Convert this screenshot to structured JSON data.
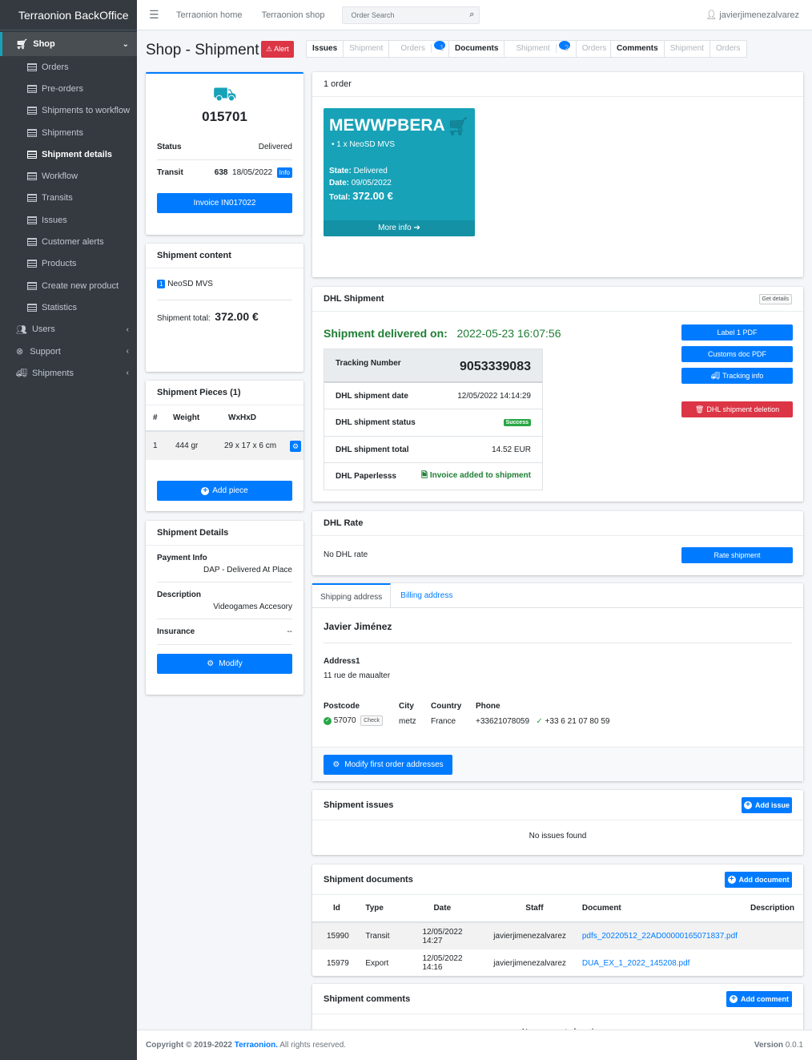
{
  "brand": "Terraonion BackOffice",
  "sidebar": {
    "shop": "Shop",
    "items": [
      "Orders",
      "Pre-orders",
      "Shipments to workflow",
      "Shipments",
      "Shipment details",
      "Workflow",
      "Transits",
      "Issues",
      "Customer alerts",
      "Products",
      "Create new product",
      "Statistics"
    ],
    "users": "Users",
    "support": "Support",
    "shipments": "Shipments"
  },
  "topbar": {
    "home": "Terraonion home",
    "shop": "Terraonion shop",
    "search_placeholder": "Order Search",
    "user": "javierjimenezalvarez"
  },
  "page": {
    "title": "Shop - Shipment",
    "alert": "Alert"
  },
  "tabs1": {
    "a": "Issues",
    "b": "Shipment",
    "c": "Orders",
    "c_badge": "1"
  },
  "tabs2": {
    "a": "Documents",
    "b": "Shipment",
    "b_badge": "2",
    "c": "Orders"
  },
  "tabs3": {
    "a": "Comments",
    "b": "Shipment",
    "c": "Orders"
  },
  "summary": {
    "number": "015701",
    "status_label": "Status",
    "status_value": "Delivered",
    "transit_label": "Transit",
    "transit_id": "638",
    "transit_date": "18/05/2022",
    "info": "Info",
    "invoice_btn": "Invoice IN017022"
  },
  "content": {
    "title": "Shipment content",
    "qty": "1",
    "item": "NeoSD MVS",
    "total_label": "Shipment total:",
    "total_value": "372.00 €"
  },
  "pieces": {
    "title": "Shipment Pieces (1)",
    "h_num": "#",
    "h_weight": "Weight",
    "h_dim": "WxHxD",
    "row_num": "1",
    "row_weight": "444 gr",
    "row_dim": "29 x 17 x 6 cm",
    "add_btn": "Add piece"
  },
  "details": {
    "title": "Shipment Details",
    "pay_label": "Payment Info",
    "pay_value": "DAP - Delivered At Place",
    "desc_label": "Description",
    "desc_value": "Videogames Accesory",
    "ins_label": "Insurance",
    "ins_value": "--",
    "modify_btn": "Modify"
  },
  "orders": {
    "count": "1 order",
    "code": "MEWWPBERA",
    "line": "1 x NeoSD MVS",
    "state_label": "State:",
    "state": "Delivered",
    "date_label": "Date:",
    "date": "09/05/2022",
    "total_label": "Total:",
    "total": "372.00 €",
    "more": "More info"
  },
  "dhl": {
    "title": "DHL Shipment",
    "get_details": "Get details",
    "delivered_label": "Shipment delivered on:",
    "delivered_at": "2022-05-23 16:07:56",
    "tracking_label": "Tracking Number",
    "tracking": "9053339083",
    "date_label": "DHL shipment date",
    "date": "12/05/2022 14:14:29",
    "status_label": "DHL shipment status",
    "status": "Success",
    "total_label": "DHL shipment total",
    "total": "14.52 EUR",
    "paperless_label": "DHL Paperlesss",
    "paperless": "Invoice added to shipment",
    "btn_label": "Label 1 PDF",
    "btn_customs": "Customs doc PDF",
    "btn_tracking": "Tracking info",
    "btn_delete": "DHL shipment deletion"
  },
  "rate": {
    "title": "DHL Rate",
    "text": "No DHL rate",
    "btn": "Rate shipment"
  },
  "address": {
    "tab_ship": "Shipping address",
    "tab_bill": "Billing address",
    "name": "Javier Jiménez",
    "addr_label": "Address1",
    "addr": "11 rue de maualter",
    "pc_label": "Postcode",
    "pc": "57070",
    "check": "Check",
    "city_label": "City",
    "city": "metz",
    "country_label": "Country",
    "country": "France",
    "phone_label": "Phone",
    "phone": "+33621078059",
    "phone2": "+33 6 21 07 80 59",
    "modify_btn": "Modify first order addresses"
  },
  "issues": {
    "title": "Shipment issues",
    "btn": "Add issue",
    "empty": "No issues found"
  },
  "documents": {
    "title": "Shipment documents",
    "btn": "Add document",
    "headers": [
      "Id",
      "Type",
      "Date",
      "Staff",
      "Document",
      "Description"
    ],
    "rows": [
      [
        "15990",
        "Transit",
        "12/05/2022 14:27",
        "javierjimenezalvarez",
        "pdfs_20220512_22AD00000165071837.pdf",
        ""
      ],
      [
        "15979",
        "Export",
        "12/05/2022 14:16",
        "javierjimenezalvarez",
        "DUA_EX_1_2022_145208.pdf",
        ""
      ]
    ]
  },
  "comments": {
    "title": "Shipment comments",
    "btn": "Add comment",
    "empty": "No comments found"
  },
  "footer": {
    "copy": "Copyright © 2019-2022",
    "company": "Terraonion.",
    "rights": "All rights reserved.",
    "version_label": "Version",
    "version": "0.0.1"
  },
  "colors": {
    "primary": "#007bff",
    "danger": "#dc3545",
    "success": "#28a745",
    "teal": "#17a2b8",
    "sidebar": "#343a40"
  }
}
